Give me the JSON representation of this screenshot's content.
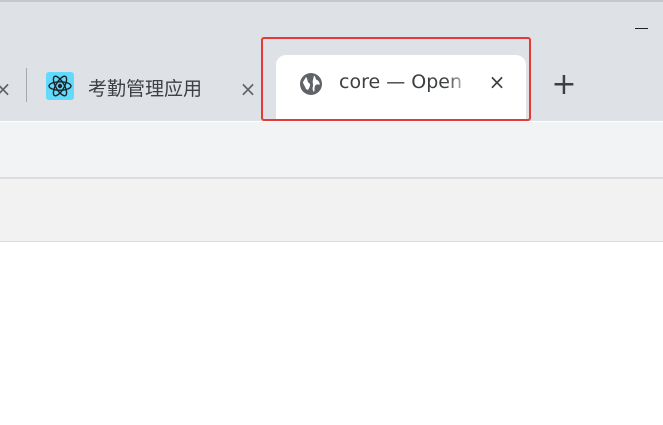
{
  "window": {
    "minimize_icon": "minimize-icon"
  },
  "tabs": [
    {
      "partial": true,
      "close_label": "×",
      "close_icon": "close-icon"
    },
    {
      "title": "考勤管理应用",
      "favicon": "react-icon",
      "close_label": "×",
      "close_icon": "close-icon",
      "favicon_color": "#61dafb"
    },
    {
      "title": "core — Open",
      "favicon": "globe-icon",
      "close_label": "×",
      "close_icon": "close-icon",
      "active": true
    }
  ],
  "new_tab": {
    "label": "+",
    "icon": "plus-icon"
  },
  "annotation": {
    "color": "#e53935"
  }
}
